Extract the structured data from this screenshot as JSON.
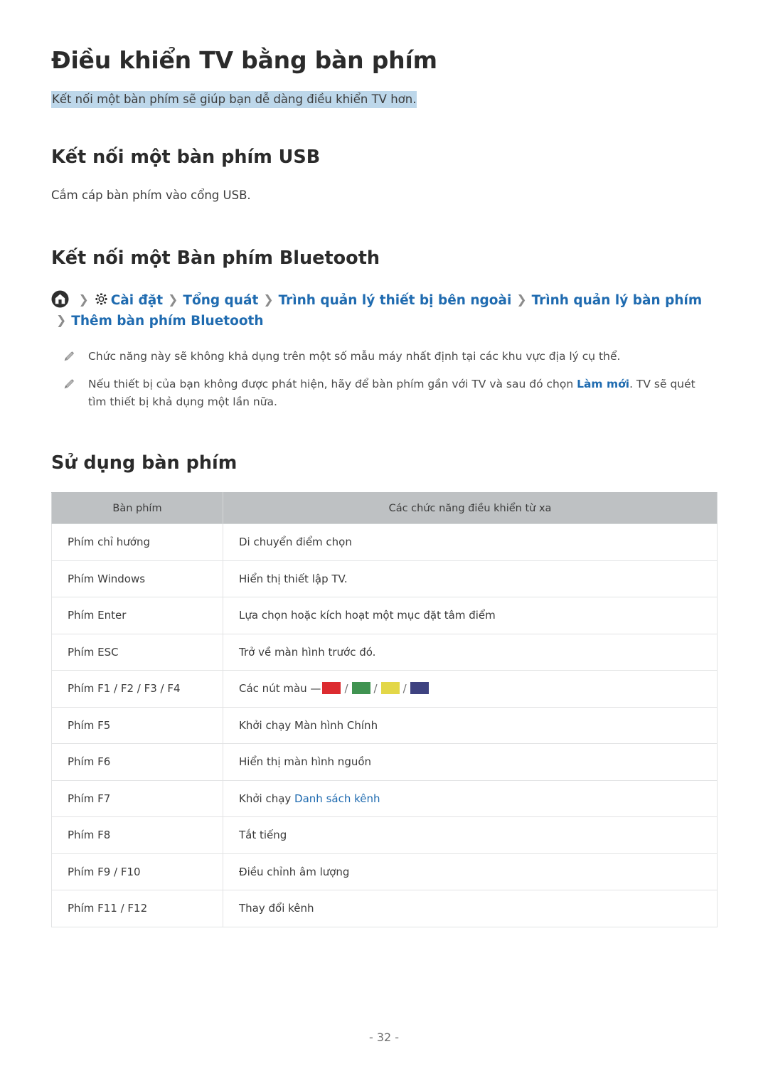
{
  "document": {
    "title": "Điều khiển TV bằng bàn phím",
    "subtitle": "Kết nối một bàn phím sẽ giúp bạn dễ dàng điều khiển TV hơn.",
    "page_number": "- 32 -"
  },
  "sections": {
    "usb": {
      "heading": "Kết nối một bàn phím USB",
      "body": "Cắm cáp bàn phím vào cổng USB."
    },
    "bluetooth": {
      "heading": "Kết nối một Bàn phím Bluetooth"
    },
    "usage": {
      "heading": "Sử dụng bàn phím"
    }
  },
  "breadcrumb": {
    "home_icon": "home-icon",
    "gear_icon": "gear-icon",
    "separator": "❯",
    "items": [
      "Cài đặt",
      "Tổng quát",
      "Trình quản lý thiết bị bên ngoài",
      "Trình quản lý bàn phím",
      "Thêm bàn phím Bluetooth"
    ]
  },
  "notes": [
    {
      "icon": "pencil-icon",
      "text_before": "Chức năng này sẽ không khả dụng trên một số mẫu máy nhất định tại các khu vực địa lý cụ thể.",
      "link": "",
      "text_after": ""
    },
    {
      "icon": "pencil-icon",
      "text_before": "Nếu thiết bị của bạn không được phát hiện, hãy để bàn phím gần với TV và sau đó chọn ",
      "link": "Làm mới",
      "text_after": ". TV sẽ quét tìm thiết bị khả dụng một lần nữa."
    }
  ],
  "table": {
    "headers": [
      "Bàn phím",
      "Các chức năng điều khiển từ xa"
    ],
    "rows": [
      {
        "key": "Phím chỉ hướng",
        "func": "Di chuyển điểm chọn"
      },
      {
        "key": "Phím Windows",
        "func": "Hiển thị thiết lập TV."
      },
      {
        "key": "Phím Enter",
        "func": "Lựa chọn hoặc kích hoạt một mục đặt tâm điểm"
      },
      {
        "key": "Phím ESC",
        "func": "Trở về màn hình trước đó."
      },
      {
        "key": "Phím F1 / F2 / F3 / F4",
        "func": "Các nút màu —",
        "swatches": true
      },
      {
        "key": "Phím F5",
        "func": "Khởi chạy Màn hình Chính"
      },
      {
        "key": "Phím F6",
        "func": "Hiển thị màn hình nguồn"
      },
      {
        "key": "Phím F7",
        "func": "Khởi chạy ",
        "link": "Danh sách kênh"
      },
      {
        "key": "Phím F8",
        "func": "Tắt tiếng"
      },
      {
        "key": "Phím F9 / F10",
        "func": "Điều chỉnh âm lượng"
      },
      {
        "key": "Phím F11 / F12",
        "func": "Thay đổi kênh"
      }
    ],
    "color_buttons": [
      {
        "name": "red-button",
        "color": "#dc2b30"
      },
      {
        "name": "green-button",
        "color": "#409351"
      },
      {
        "name": "yellow-button",
        "color": "#e3d748"
      },
      {
        "name": "blue-button",
        "color": "#3e4280"
      }
    ],
    "swatch_separator": "/"
  },
  "colors": {
    "link": "#1f6bb0",
    "highlight": "#bdd7ea",
    "table_header_bg": "#bec1c3"
  }
}
